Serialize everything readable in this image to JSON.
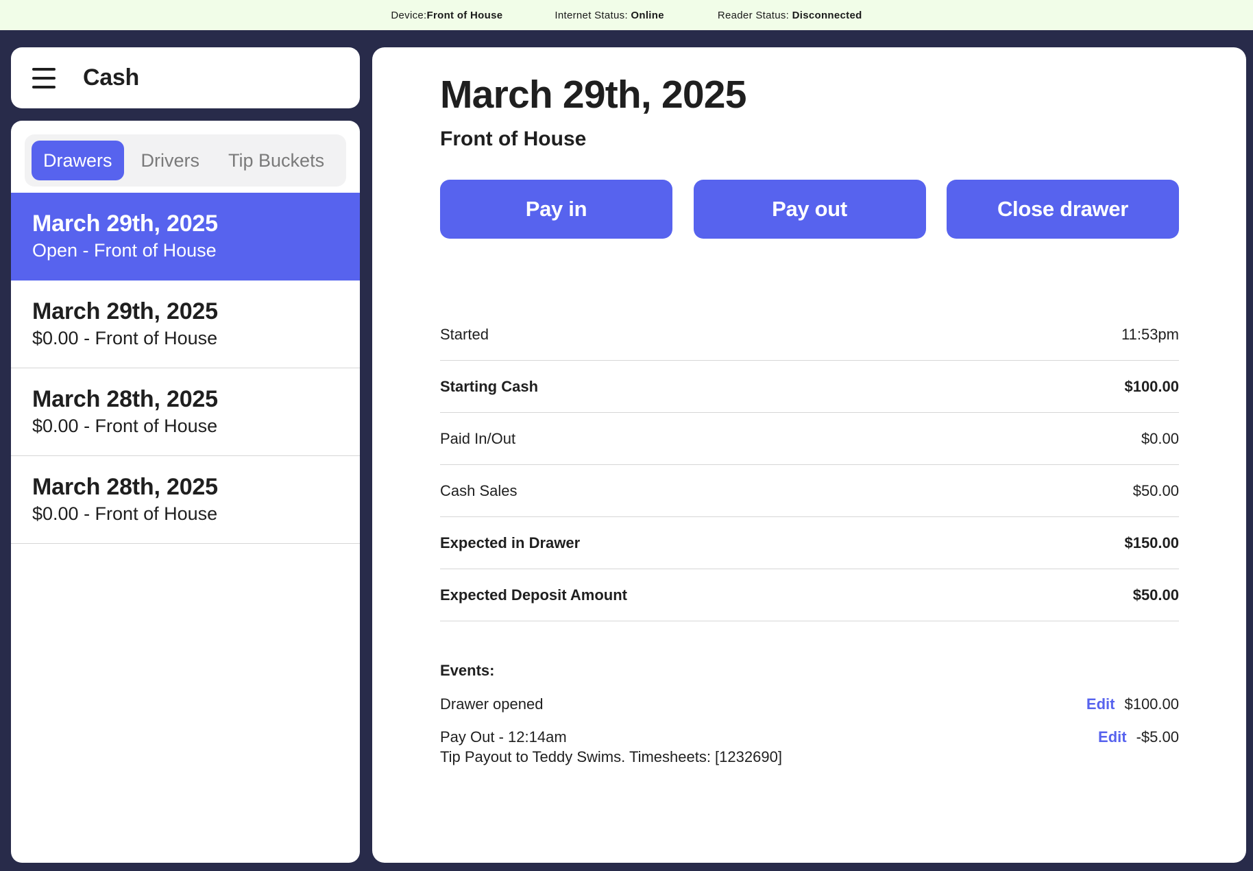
{
  "status_bar": {
    "device_label": "Device:",
    "device_value": "Front of House",
    "internet_label": "Internet Status:",
    "internet_value": "Online",
    "reader_label": "Reader Status:",
    "reader_value": "Disconnected"
  },
  "header": {
    "menu_icon": "hamburger-menu-icon",
    "title": "Cash"
  },
  "tabs": [
    {
      "label": "Drawers",
      "active": true
    },
    {
      "label": "Drivers",
      "active": false
    },
    {
      "label": "Tip Buckets",
      "active": false
    }
  ],
  "drawers": [
    {
      "date": "March 29th, 2025",
      "subtitle": "Open - Front of House",
      "selected": true
    },
    {
      "date": "March 29th, 2025",
      "subtitle": "$0.00 - Front of House",
      "selected": false
    },
    {
      "date": "March 28th, 2025",
      "subtitle": "$0.00 - Front of House",
      "selected": false
    },
    {
      "date": "March 28th, 2025",
      "subtitle": "$0.00 - Front of House",
      "selected": false
    }
  ],
  "detail": {
    "title": "March 29th, 2025",
    "subtitle": "Front of House",
    "actions": [
      "Pay in",
      "Pay out",
      "Close drawer"
    ],
    "summary": [
      {
        "label": "Started",
        "value": "11:53pm",
        "bold": false
      },
      {
        "label": "Starting Cash",
        "value": "$100.00",
        "bold": true
      },
      {
        "label": "Paid In/Out",
        "value": "$0.00",
        "bold": false
      },
      {
        "label": "Cash Sales",
        "value": "$50.00",
        "bold": false
      },
      {
        "label": "Expected in Drawer",
        "value": "$150.00",
        "bold": true
      },
      {
        "label": "Expected Deposit Amount",
        "value": "$50.00",
        "bold": true
      }
    ],
    "events_title": "Events:",
    "events": [
      {
        "line1": "Drawer opened",
        "line2": "",
        "edit_label": "Edit",
        "amount": "$100.00"
      },
      {
        "line1": "Pay Out - 12:14am",
        "line2": "Tip Payout to Teddy Swims. Timesheets: [1232690]",
        "edit_label": "Edit",
        "amount": "-$5.00"
      }
    ]
  },
  "colors": {
    "accent": "#5763ee",
    "background": "#282b4a",
    "status_bar": "#f1fde8"
  }
}
